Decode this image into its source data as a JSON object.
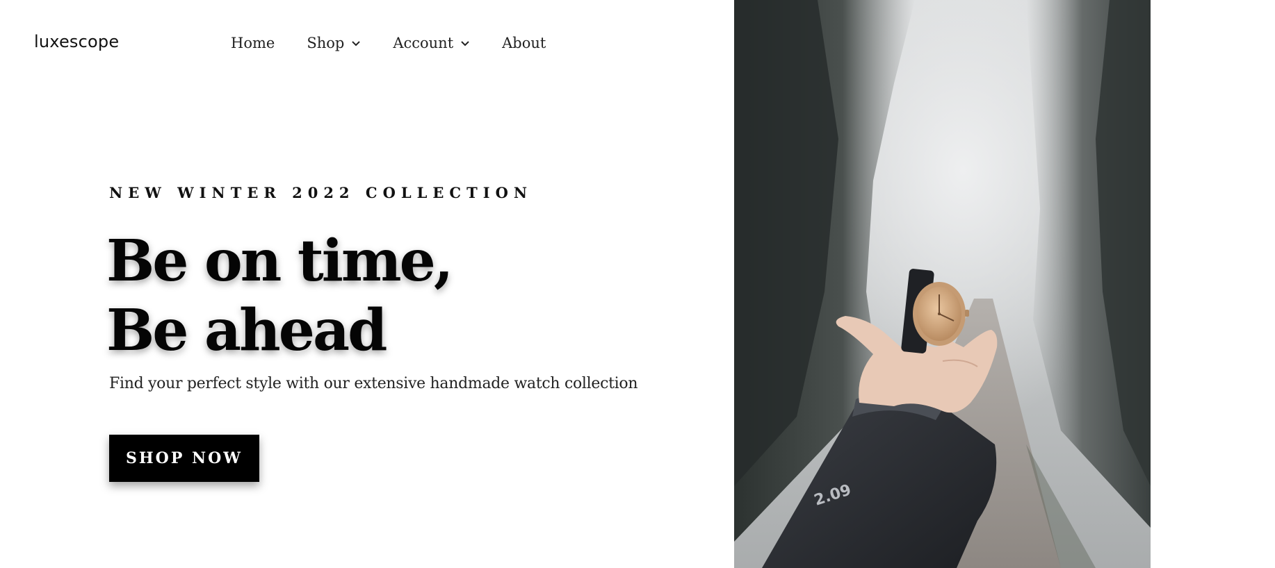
{
  "brand": {
    "logo": "luxescope"
  },
  "nav": {
    "items": [
      {
        "label": "Home",
        "has_dropdown": false
      },
      {
        "label": "Shop",
        "has_dropdown": true
      },
      {
        "label": "Account",
        "has_dropdown": true
      },
      {
        "label": "About",
        "has_dropdown": false
      }
    ]
  },
  "hero": {
    "eyebrow": "NEW WINTER 2022 COLLECTION",
    "headline_line1": "Be on time,",
    "headline_line2": "Be ahead",
    "subtitle": "Find your perfect style with our extensive handmade watch collection",
    "cta_label": "SHOP NOW",
    "image": {
      "alt": "Hand holding a rose gold watch on a misty forest path",
      "sleeve_text": "2.09"
    }
  },
  "colors": {
    "text": "#111111",
    "button_bg": "#000000",
    "button_text": "#ffffff",
    "background": "#ffffff"
  }
}
